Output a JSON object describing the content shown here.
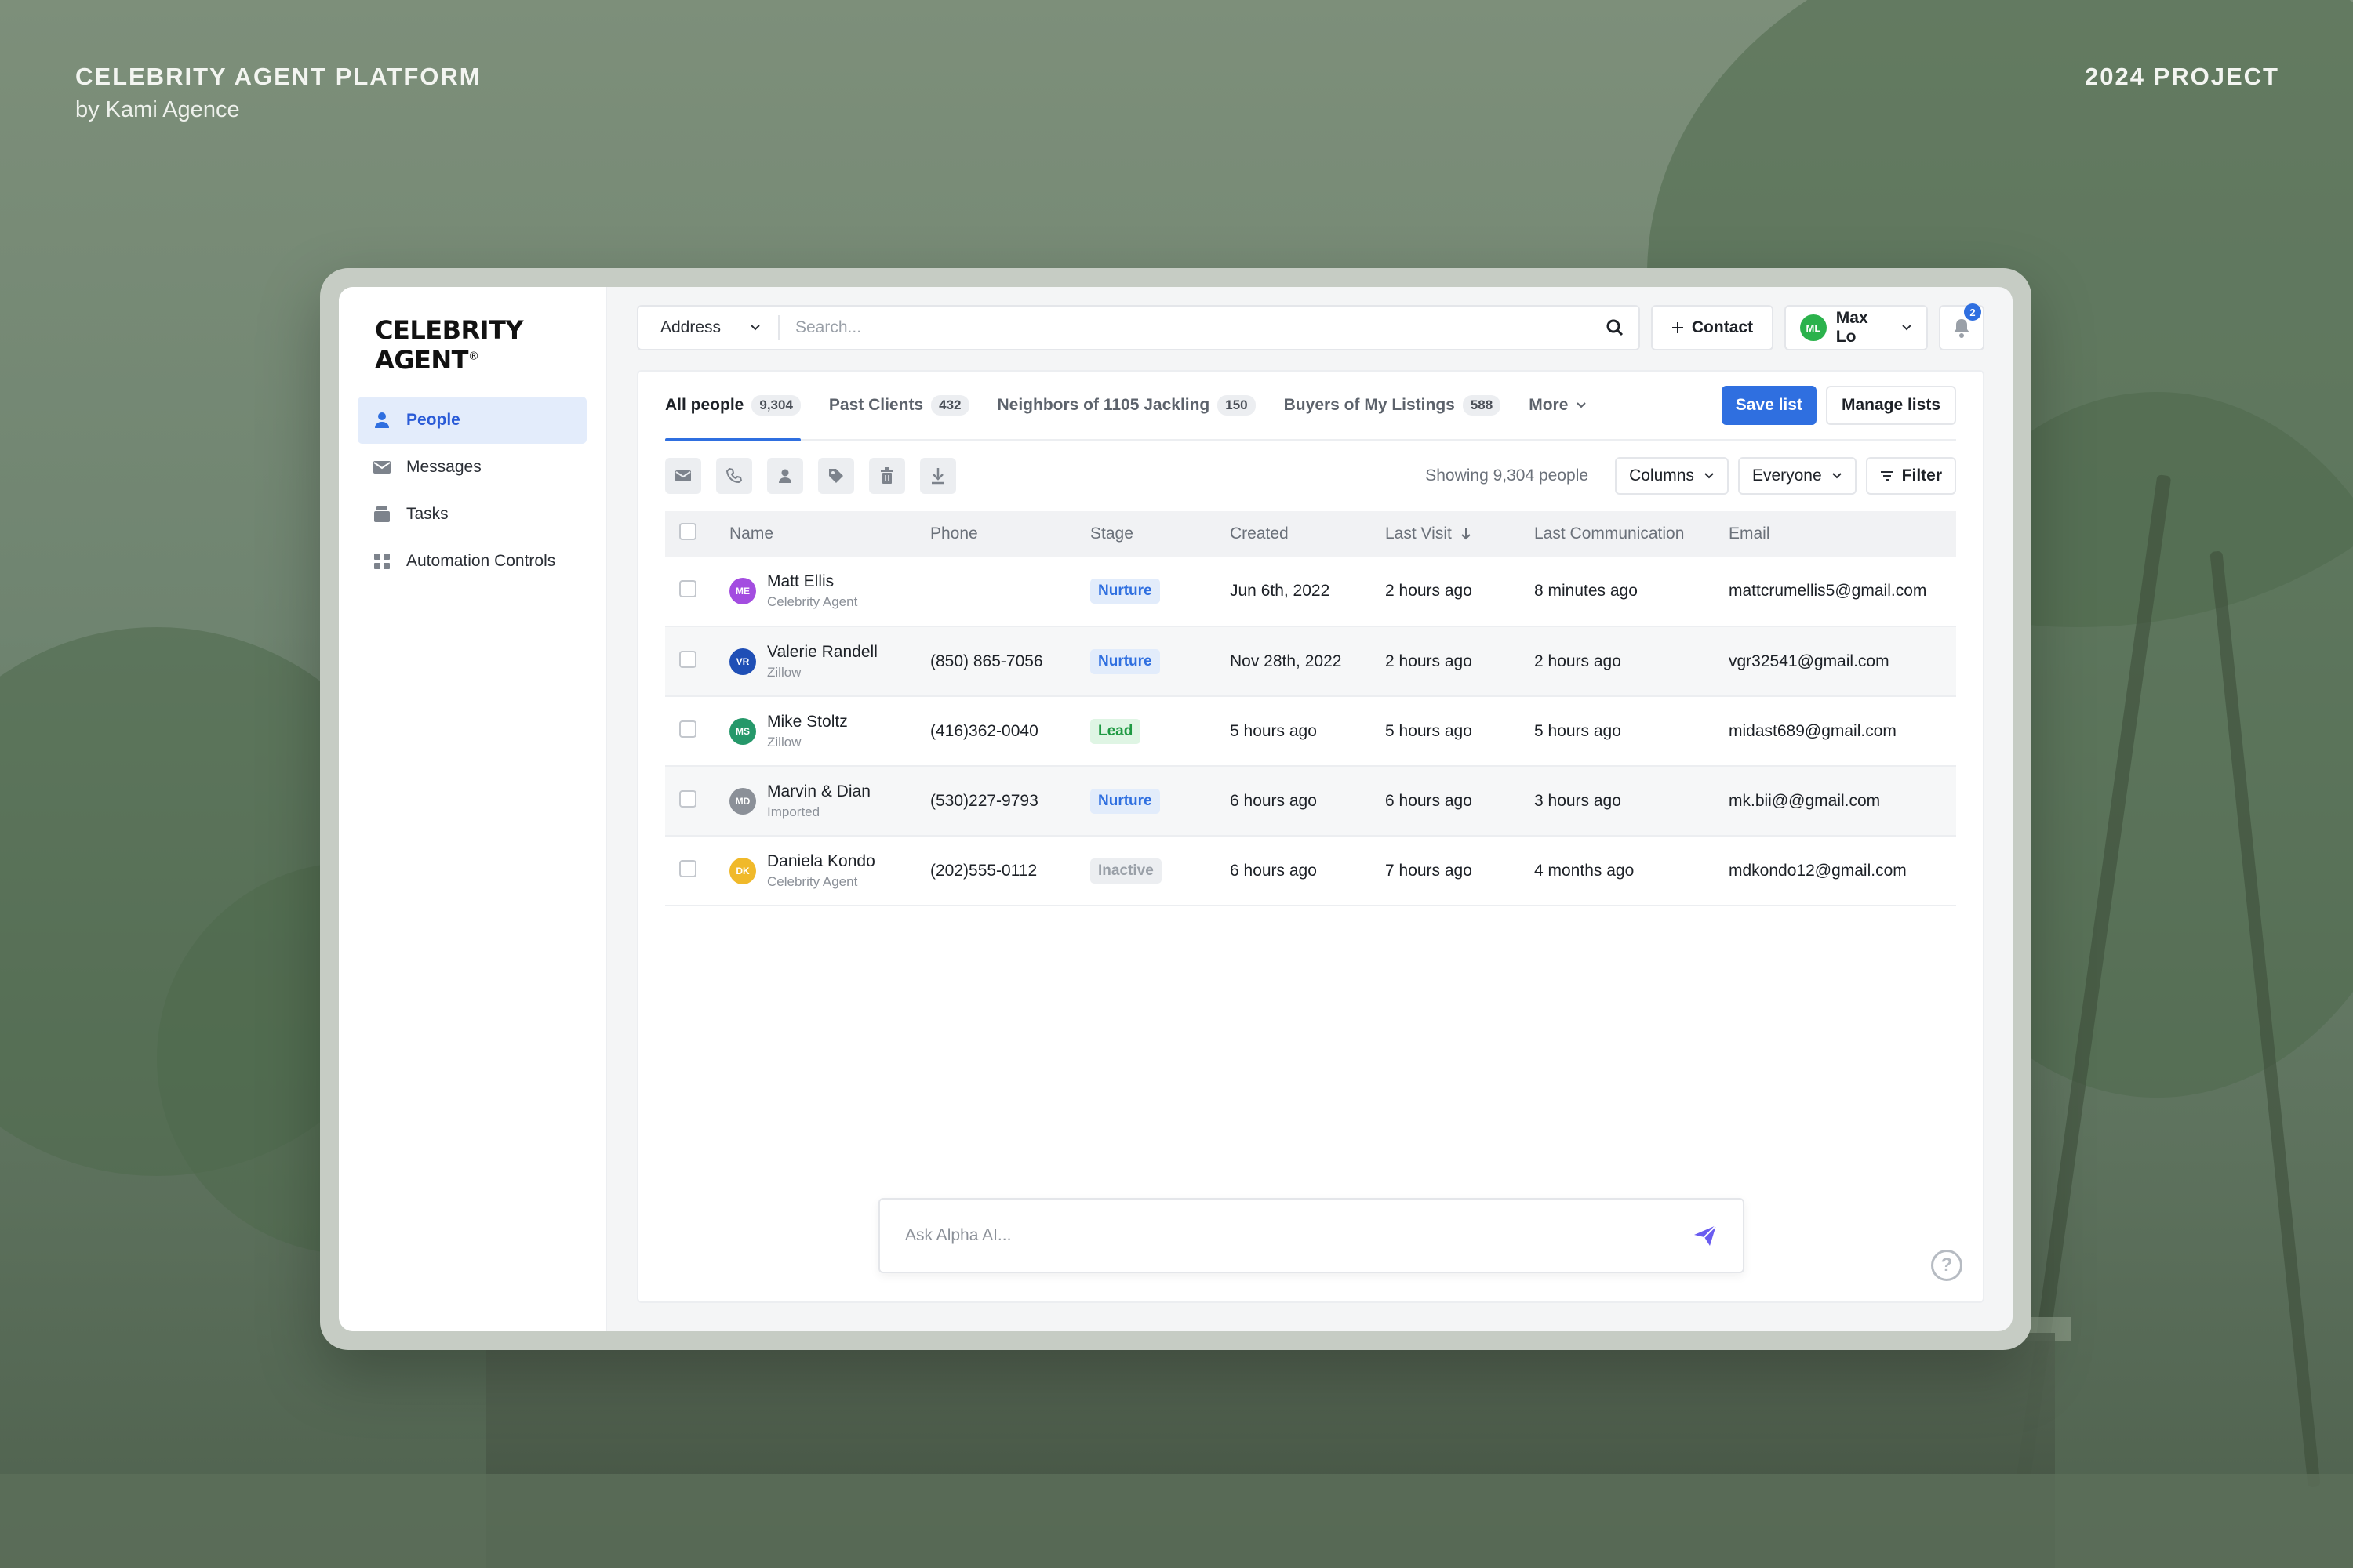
{
  "showcase": {
    "title": "CELEBRITY AGENT PLATFORM",
    "subtitle": "by Kami Agence",
    "project": "2024 PROJECT"
  },
  "app": {
    "logo": "CELEBRITY AGENT",
    "logo_mark": "®"
  },
  "sidebar": {
    "items": [
      {
        "label": "People",
        "icon": "person-icon",
        "active": true
      },
      {
        "label": "Messages",
        "icon": "envelope-icon",
        "active": false
      },
      {
        "label": "Tasks",
        "icon": "tasks-icon",
        "active": false
      },
      {
        "label": "Automation Controls",
        "icon": "grid-icon",
        "active": false
      }
    ]
  },
  "topbar": {
    "address_label": "Address",
    "search_placeholder": "Search...",
    "contact_label": "Contact",
    "user_initials": "ML",
    "user_name": "Max Lo",
    "notification_count": "2"
  },
  "tabs": [
    {
      "label": "All people",
      "count": "9,304",
      "active": true
    },
    {
      "label": "Past Clients",
      "count": "432",
      "active": false
    },
    {
      "label": "Neighbors of 1105 Jackling",
      "count": "150",
      "active": false
    },
    {
      "label": "Buyers of My Listings",
      "count": "588",
      "active": false
    }
  ],
  "tabs_more": "More",
  "actions": {
    "save_list": "Save list",
    "manage_lists": "Manage lists"
  },
  "toolbar": {
    "tools": [
      "mail-icon",
      "phone-icon",
      "user-icon",
      "tag-icon",
      "trash-icon",
      "download-icon"
    ],
    "showing": "Showing 9,304 people",
    "columns": "Columns",
    "everyone": "Everyone",
    "filter": "Filter"
  },
  "table": {
    "headers": {
      "name": "Name",
      "phone": "Phone",
      "stage": "Stage",
      "created": "Created",
      "last_visit": "Last Visit",
      "last_comm": "Last Communication",
      "email": "Email"
    },
    "rows": [
      {
        "initials": "ME",
        "name": "Matt Ellis",
        "source": "Celebrity Agent",
        "phone": "",
        "stage": "Nurture",
        "created": "Jun 6th, 2022",
        "last_visit": "2 hours ago",
        "last_comm": "8 minutes ago",
        "email": "mattcrumellis5@gmail.com"
      },
      {
        "initials": "VR",
        "name": "Valerie Randell",
        "source": "Zillow",
        "phone": "(850) 865-7056",
        "stage": "Nurture",
        "created": "Nov 28th, 2022",
        "last_visit": "2 hours ago",
        "last_comm": "2 hours ago",
        "email": "vgr32541@gmail.com"
      },
      {
        "initials": "MS",
        "name": "Mike Stoltz",
        "source": "Zillow",
        "phone": "(416)362-0040",
        "stage": "Lead",
        "created": "5 hours ago",
        "last_visit": "5 hours ago",
        "last_comm": "5 hours ago",
        "email": "midast689@gmail.com"
      },
      {
        "initials": "MD",
        "name": "Marvin & Dian",
        "source": "Imported",
        "phone": "(530)227-9793",
        "stage": "Nurture",
        "created": "6 hours ago",
        "last_visit": "6 hours ago",
        "last_comm": "3 hours ago",
        "email": "mk.bii@@gmail.com"
      },
      {
        "initials": "DK",
        "name": "Daniela Kondo",
        "source": "Celebrity Agent",
        "phone": "(202)555-0112",
        "stage": "Inactive",
        "created": "6 hours ago",
        "last_visit": "7 hours ago",
        "last_comm": "4 months ago",
        "email": "mdkondo12@gmail.com"
      }
    ]
  },
  "ask": {
    "placeholder": "Ask Alpha AI..."
  },
  "help_glyph": "?",
  "colors": {
    "accent": "#2f6fe0",
    "nurture_bg": "#e2ecfb",
    "nurture_fg": "#2f6fe0",
    "lead_bg": "#dff5e4",
    "lead_fg": "#1f9a43",
    "inactive_bg": "#eceef1",
    "inactive_fg": "#9aa0a8",
    "avatars": [
      "#a34de0",
      "#1f4fb6",
      "#25986a",
      "#8b9098",
      "#f0b92a"
    ]
  }
}
